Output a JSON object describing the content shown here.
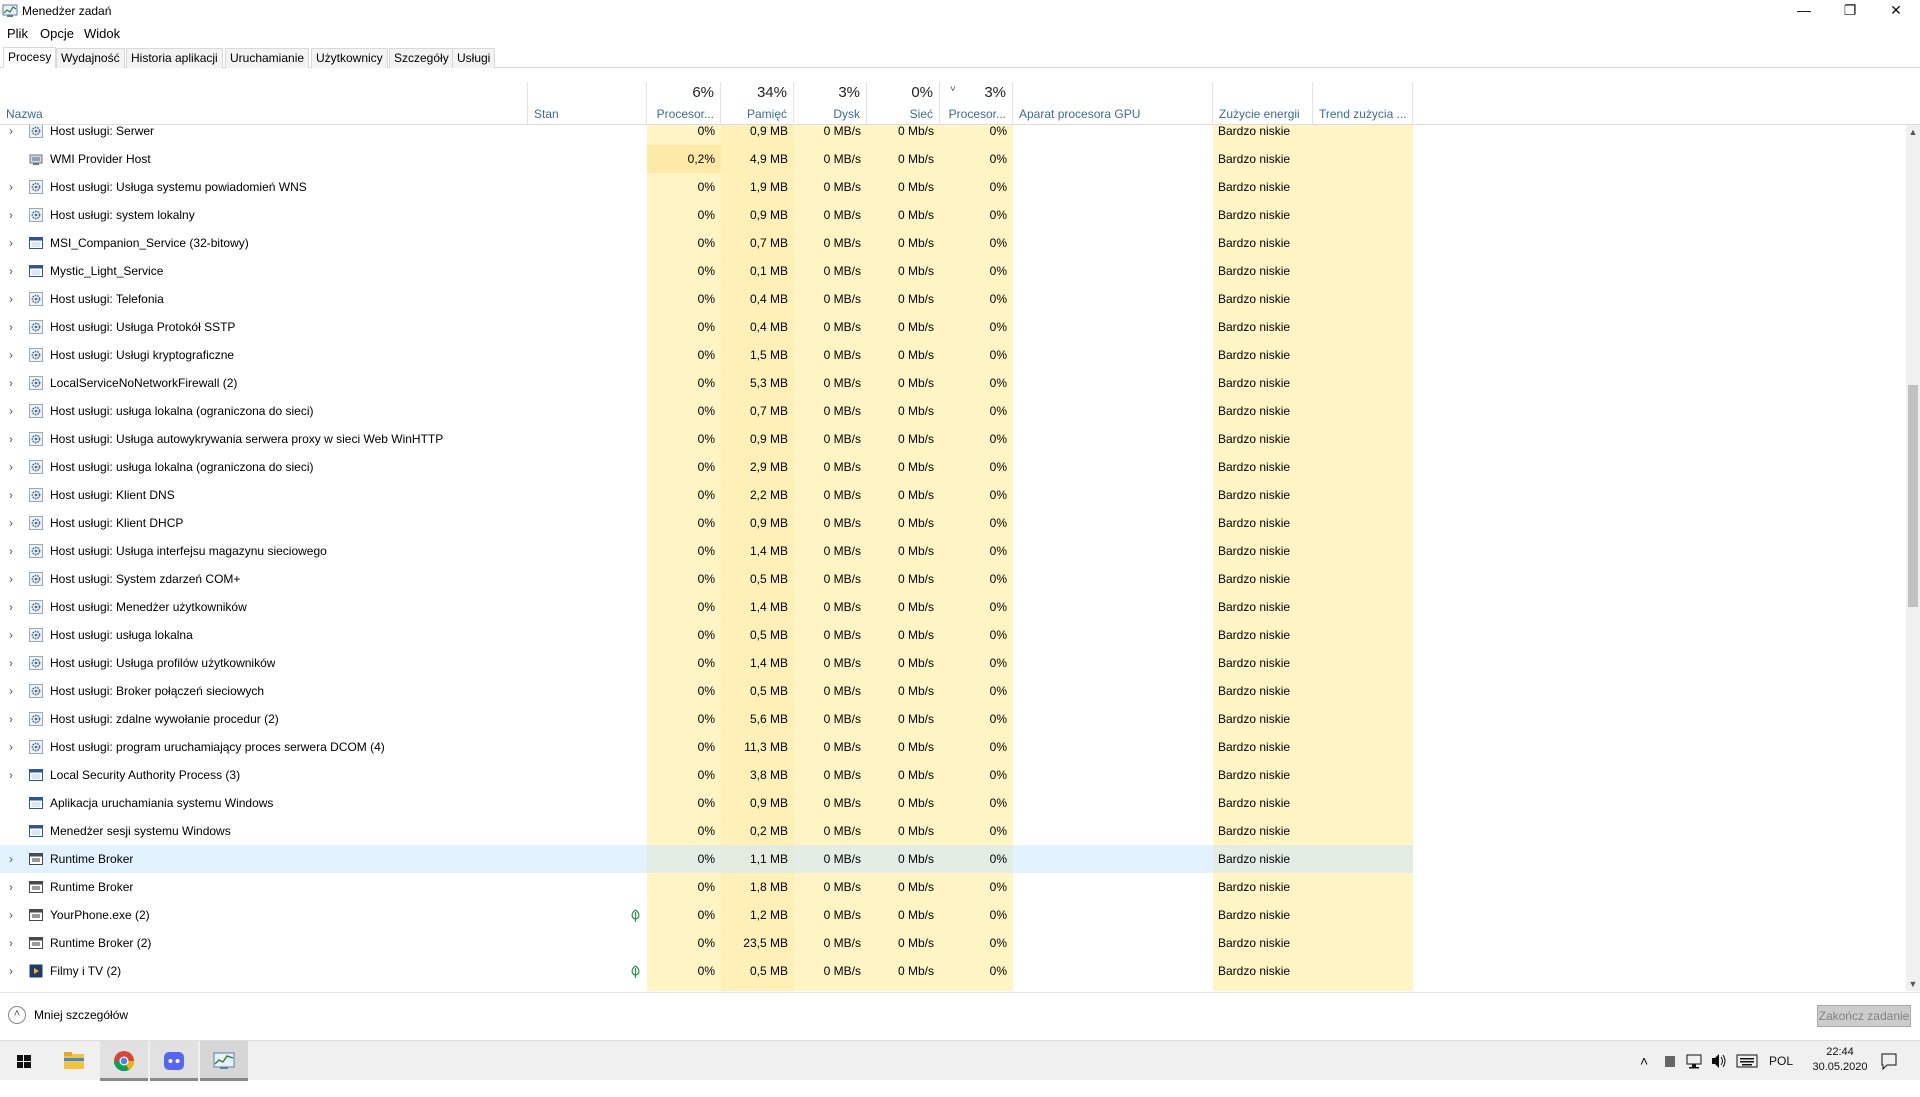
{
  "window": {
    "title": "Menedżer zadań",
    "minimize_glyph": "—",
    "maximize_glyph": "❐",
    "close_glyph": "✕"
  },
  "menu": [
    "Plik",
    "Opcje",
    "Widok"
  ],
  "tabs": [
    "Procesy",
    "Wydajność",
    "Historia aplikacji",
    "Uruchamianie",
    "Użytkownicy",
    "Szczegóły",
    "Usługi"
  ],
  "active_tab": "Procesy",
  "columns": {
    "name": {
      "label": "Nazwa"
    },
    "status": {
      "label": "Stan"
    },
    "cpu": {
      "label": "Procesor...",
      "pct": "6%"
    },
    "memory": {
      "label": "Pamięć",
      "pct": "34%"
    },
    "disk": {
      "label": "Dysk",
      "pct": "3%"
    },
    "network": {
      "label": "Sieć",
      "pct": "0%"
    },
    "gpu": {
      "label": "Procesor...",
      "pct": "3%",
      "sort_glyph": "˅"
    },
    "gpu_engine": {
      "label": "Aparat procesora GPU"
    },
    "power": {
      "label": "Zużycie energii"
    },
    "power_trend": {
      "label": "Trend zużycia ..."
    }
  },
  "processes": [
    {
      "name": "Host usługi: Serwer",
      "icon": "gear-icon",
      "expand": true,
      "cpu": "0%",
      "mem": "0,9 MB",
      "disk": "0 MB/s",
      "net": "0 Mb/s",
      "gpu": "0%",
      "power": "Bardzo niskie"
    },
    {
      "name": "WMI Provider Host",
      "icon": "wmi-icon",
      "expand": false,
      "cpu": "0,2%",
      "mem": "4,9 MB",
      "disk": "0 MB/s",
      "net": "0 Mb/s",
      "gpu": "0%",
      "power": "Bardzo niskie"
    },
    {
      "name": "Host usługi: Usługa systemu powiadomień WNS",
      "icon": "gear-icon",
      "expand": true,
      "cpu": "0%",
      "mem": "1,9 MB",
      "disk": "0 MB/s",
      "net": "0 Mb/s",
      "gpu": "0%",
      "power": "Bardzo niskie"
    },
    {
      "name": "Host usługi: system lokalny",
      "icon": "gear-icon",
      "expand": true,
      "cpu": "0%",
      "mem": "0,9 MB",
      "disk": "0 MB/s",
      "net": "0 Mb/s",
      "gpu": "0%",
      "power": "Bardzo niskie"
    },
    {
      "name": "MSI_Companion_Service (32-bitowy)",
      "icon": "app-window-icon",
      "expand": true,
      "cpu": "0%",
      "mem": "0,7 MB",
      "disk": "0 MB/s",
      "net": "0 Mb/s",
      "gpu": "0%",
      "power": "Bardzo niskie"
    },
    {
      "name": "Mystic_Light_Service",
      "icon": "app-window-icon",
      "expand": true,
      "cpu": "0%",
      "mem": "0,1 MB",
      "disk": "0 MB/s",
      "net": "0 Mb/s",
      "gpu": "0%",
      "power": "Bardzo niskie"
    },
    {
      "name": "Host usługi: Telefonia",
      "icon": "gear-icon",
      "expand": true,
      "cpu": "0%",
      "mem": "0,4 MB",
      "disk": "0 MB/s",
      "net": "0 Mb/s",
      "gpu": "0%",
      "power": "Bardzo niskie"
    },
    {
      "name": "Host usługi: Usługa Protokół SSTP",
      "icon": "gear-icon",
      "expand": true,
      "cpu": "0%",
      "mem": "0,4 MB",
      "disk": "0 MB/s",
      "net": "0 Mb/s",
      "gpu": "0%",
      "power": "Bardzo niskie"
    },
    {
      "name": "Host usługi: Usługi kryptograficzne",
      "icon": "gear-icon",
      "expand": true,
      "cpu": "0%",
      "mem": "1,5 MB",
      "disk": "0 MB/s",
      "net": "0 Mb/s",
      "gpu": "0%",
      "power": "Bardzo niskie"
    },
    {
      "name": "LocalServiceNoNetworkFirewall (2)",
      "icon": "gear-icon",
      "expand": true,
      "cpu": "0%",
      "mem": "5,3 MB",
      "disk": "0 MB/s",
      "net": "0 Mb/s",
      "gpu": "0%",
      "power": "Bardzo niskie"
    },
    {
      "name": "Host usługi: usługa lokalna (ograniczona do sieci)",
      "icon": "gear-icon",
      "expand": true,
      "cpu": "0%",
      "mem": "0,7 MB",
      "disk": "0 MB/s",
      "net": "0 Mb/s",
      "gpu": "0%",
      "power": "Bardzo niskie"
    },
    {
      "name": "Host usługi: Usługa autowykrywania serwera proxy w sieci Web WinHTTP",
      "icon": "gear-icon",
      "expand": true,
      "cpu": "0%",
      "mem": "0,9 MB",
      "disk": "0 MB/s",
      "net": "0 Mb/s",
      "gpu": "0%",
      "power": "Bardzo niskie"
    },
    {
      "name": "Host usługi: usługa lokalna (ograniczona do sieci)",
      "icon": "gear-icon",
      "expand": true,
      "cpu": "0%",
      "mem": "2,9 MB",
      "disk": "0 MB/s",
      "net": "0 Mb/s",
      "gpu": "0%",
      "power": "Bardzo niskie"
    },
    {
      "name": "Host usługi: Klient DNS",
      "icon": "gear-icon",
      "expand": true,
      "cpu": "0%",
      "mem": "2,2 MB",
      "disk": "0 MB/s",
      "net": "0 Mb/s",
      "gpu": "0%",
      "power": "Bardzo niskie"
    },
    {
      "name": "Host usługi: Klient DHCP",
      "icon": "gear-icon",
      "expand": true,
      "cpu": "0%",
      "mem": "0,9 MB",
      "disk": "0 MB/s",
      "net": "0 Mb/s",
      "gpu": "0%",
      "power": "Bardzo niskie"
    },
    {
      "name": "Host usługi: Usługa interfejsu magazynu sieciowego",
      "icon": "gear-icon",
      "expand": true,
      "cpu": "0%",
      "mem": "1,4 MB",
      "disk": "0 MB/s",
      "net": "0 Mb/s",
      "gpu": "0%",
      "power": "Bardzo niskie"
    },
    {
      "name": "Host usługi: System zdarzeń COM+",
      "icon": "gear-icon",
      "expand": true,
      "cpu": "0%",
      "mem": "0,5 MB",
      "disk": "0 MB/s",
      "net": "0 Mb/s",
      "gpu": "0%",
      "power": "Bardzo niskie"
    },
    {
      "name": "Host usługi: Menedżer użytkowników",
      "icon": "gear-icon",
      "expand": true,
      "cpu": "0%",
      "mem": "1,4 MB",
      "disk": "0 MB/s",
      "net": "0 Mb/s",
      "gpu": "0%",
      "power": "Bardzo niskie"
    },
    {
      "name": "Host usługi: usługa lokalna",
      "icon": "gear-icon",
      "expand": true,
      "cpu": "0%",
      "mem": "0,5 MB",
      "disk": "0 MB/s",
      "net": "0 Mb/s",
      "gpu": "0%",
      "power": "Bardzo niskie"
    },
    {
      "name": "Host usługi: Usługa profilów użytkowników",
      "icon": "gear-icon",
      "expand": true,
      "cpu": "0%",
      "mem": "1,4 MB",
      "disk": "0 MB/s",
      "net": "0 Mb/s",
      "gpu": "0%",
      "power": "Bardzo niskie"
    },
    {
      "name": "Host usługi: Broker połączeń sieciowych",
      "icon": "gear-icon",
      "expand": true,
      "cpu": "0%",
      "mem": "0,5 MB",
      "disk": "0 MB/s",
      "net": "0 Mb/s",
      "gpu": "0%",
      "power": "Bardzo niskie"
    },
    {
      "name": "Host usługi: zdalne wywołanie procedur (2)",
      "icon": "gear-icon",
      "expand": true,
      "cpu": "0%",
      "mem": "5,6 MB",
      "disk": "0 MB/s",
      "net": "0 Mb/s",
      "gpu": "0%",
      "power": "Bardzo niskie"
    },
    {
      "name": "Host usługi: program uruchamiający proces serwera DCOM (4)",
      "icon": "gear-icon",
      "expand": true,
      "cpu": "0%",
      "mem": "11,3 MB",
      "disk": "0 MB/s",
      "net": "0 Mb/s",
      "gpu": "0%",
      "power": "Bardzo niskie"
    },
    {
      "name": "Local Security Authority Process (3)",
      "icon": "app-window-icon",
      "expand": true,
      "cpu": "0%",
      "mem": "3,8 MB",
      "disk": "0 MB/s",
      "net": "0 Mb/s",
      "gpu": "0%",
      "power": "Bardzo niskie"
    },
    {
      "name": "Aplikacja uruchamiania systemu Windows",
      "icon": "app-window-icon",
      "expand": false,
      "cpu": "0%",
      "mem": "0,9 MB",
      "disk": "0 MB/s",
      "net": "0 Mb/s",
      "gpu": "0%",
      "power": "Bardzo niskie"
    },
    {
      "name": "Menedżer sesji systemu Windows",
      "icon": "app-window-icon",
      "expand": false,
      "cpu": "0%",
      "mem": "0,2 MB",
      "disk": "0 MB/s",
      "net": "0 Mb/s",
      "gpu": "0%",
      "power": "Bardzo niskie"
    },
    {
      "name": "Runtime Broker",
      "icon": "runtime-icon",
      "expand": true,
      "cpu": "0%",
      "mem": "1,1 MB",
      "disk": "0 MB/s",
      "net": "0 Mb/s",
      "gpu": "0%",
      "power": "Bardzo niskie",
      "selected": true
    },
    {
      "name": "Runtime Broker",
      "icon": "runtime-icon",
      "expand": true,
      "cpu": "0%",
      "mem": "1,8 MB",
      "disk": "0 MB/s",
      "net": "0 Mb/s",
      "gpu": "0%",
      "power": "Bardzo niskie"
    },
    {
      "name": "YourPhone.exe (2)",
      "icon": "runtime-icon",
      "expand": true,
      "cpu": "0%",
      "mem": "1,2 MB",
      "disk": "0 MB/s",
      "net": "0 Mb/s",
      "gpu": "0%",
      "power": "Bardzo niskie",
      "suspended": true
    },
    {
      "name": "Runtime Broker (2)",
      "icon": "runtime-icon",
      "expand": true,
      "cpu": "0%",
      "mem": "23,5 MB",
      "disk": "0 MB/s",
      "net": "0 Mb/s",
      "gpu": "0%",
      "power": "Bardzo niskie"
    },
    {
      "name": "Filmy i TV (2)",
      "icon": "movies-icon",
      "expand": true,
      "cpu": "0%",
      "mem": "0,5 MB",
      "disk": "0 MB/s",
      "net": "0 Mb/s",
      "gpu": "0%",
      "power": "Bardzo niskie",
      "suspended": true
    }
  ],
  "footer": {
    "less_details": "Mniej szczegółów",
    "end_task": "Zakończ zadanie"
  },
  "taskbar": {
    "apps": [
      "windows-start-icon",
      "file-explorer-icon",
      "chrome-icon",
      "discord-icon",
      "task-manager-icon"
    ],
    "language": "POL",
    "time": "22:44",
    "date": "30.05.2020"
  },
  "colors": {
    "cpu_col": "#fff4c4",
    "highlight_cell": "#ffe9a8",
    "selection": "#cce8ff",
    "header_label": "#3c6b9c"
  }
}
